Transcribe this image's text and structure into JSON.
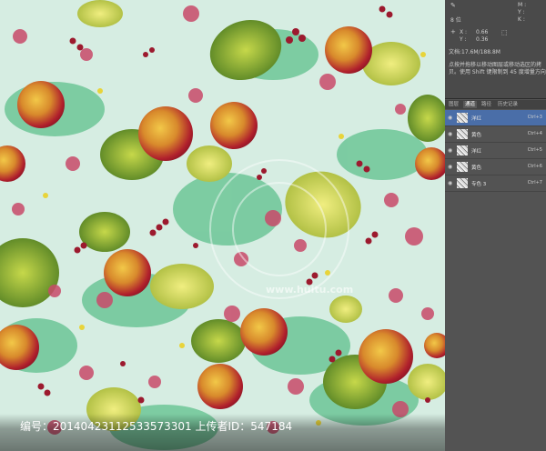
{
  "info": {
    "bits_label": "8 位",
    "x_label": "X :",
    "x_value": "0.66",
    "y_label": "Y :",
    "y_value": "0.36",
    "m_label": "M :",
    "y2_label": "Y :",
    "k_label": "K :",
    "doc_info": "文档:17.6M/188.8M",
    "hint_line1": "点按并拖移以移动图层或移动选区的拷",
    "hint_line2": "贝。使用 Shift 键限制到 45 度增量方向。"
  },
  "tabs": [
    "图层",
    "通道",
    "路径",
    "历史记录"
  ],
  "active_tab": 1,
  "layers": [
    {
      "name": "洋红",
      "shortcut": "Ctrl+3",
      "active": true
    },
    {
      "name": "黄色",
      "shortcut": "Ctrl+4",
      "active": false
    },
    {
      "name": "洋红",
      "shortcut": "Ctrl+5",
      "active": false
    },
    {
      "name": "黄色",
      "shortcut": "Ctrl+6",
      "active": false
    },
    {
      "name": "专色 3",
      "shortcut": "Ctrl+7",
      "active": false
    }
  ],
  "watermark": {
    "text": "编号：20140423112533573301 上传者ID：547184",
    "center_text": "www.huitu.com"
  },
  "colors": {
    "panel": "#535353",
    "highlight": "#4a6ea8",
    "fabric_bg": "#d9eee4",
    "pomegranate": "#b51d2a",
    "leaf": "#6a9b2a",
    "blossom": "#c94a6a"
  }
}
